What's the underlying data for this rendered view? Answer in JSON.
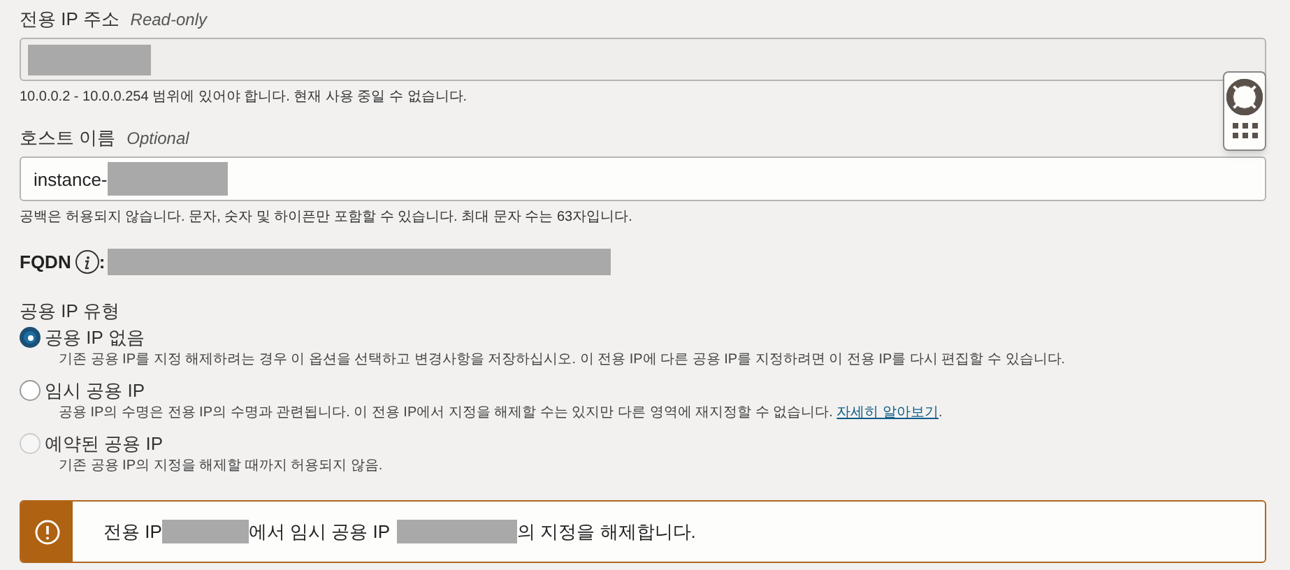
{
  "private_ip": {
    "label": "전용 IP 주소",
    "tag": "Read-only",
    "help": "10.0.0.2 - 10.0.0.254 범위에 있어야 합니다. 현재 사용 중일 수 없습니다."
  },
  "hostname": {
    "label": "호스트 이름",
    "tag": "Optional",
    "value": "instance-",
    "help": "공백은 허용되지 않습니다. 문자, 숫자 및 하이픈만 포함할 수 있습니다. 최대 문자 수는 63자입니다."
  },
  "fqdn": {
    "label": "FQDN",
    "colon": ":"
  },
  "public_ip_type": {
    "label": "공용 IP 유형",
    "options": [
      {
        "label": "공용 IP 없음",
        "selected": true,
        "disabled": false,
        "description": "기존 공용 IP를 지정 해제하려는 경우 이 옵션을 선택하고 변경사항을 저장하십시오. 이 전용 IP에 다른 공용 IP를 지정하려면 이 전용 IP를 다시 편집할 수 있습니다."
      },
      {
        "label": "임시 공용 IP",
        "selected": false,
        "disabled": false,
        "description": "공용 IP의 수명은 전용 IP의 수명과 관련됩니다. 이 전용 IP에서 지정을 해제할 수는 있지만 다른 영역에 재지정할 수 없습니다.",
        "link": "자세히 알아보기",
        "after_link": "."
      },
      {
        "label": "예약된 공용 IP",
        "selected": false,
        "disabled": true,
        "description": "기존 공용 IP의 지정을 해제할 때까지 허용되지 않음."
      }
    ]
  },
  "alert": {
    "parts": [
      "전용 IP",
      "에서 임시 공용 IP",
      "의 지정을 해제합니다."
    ]
  }
}
